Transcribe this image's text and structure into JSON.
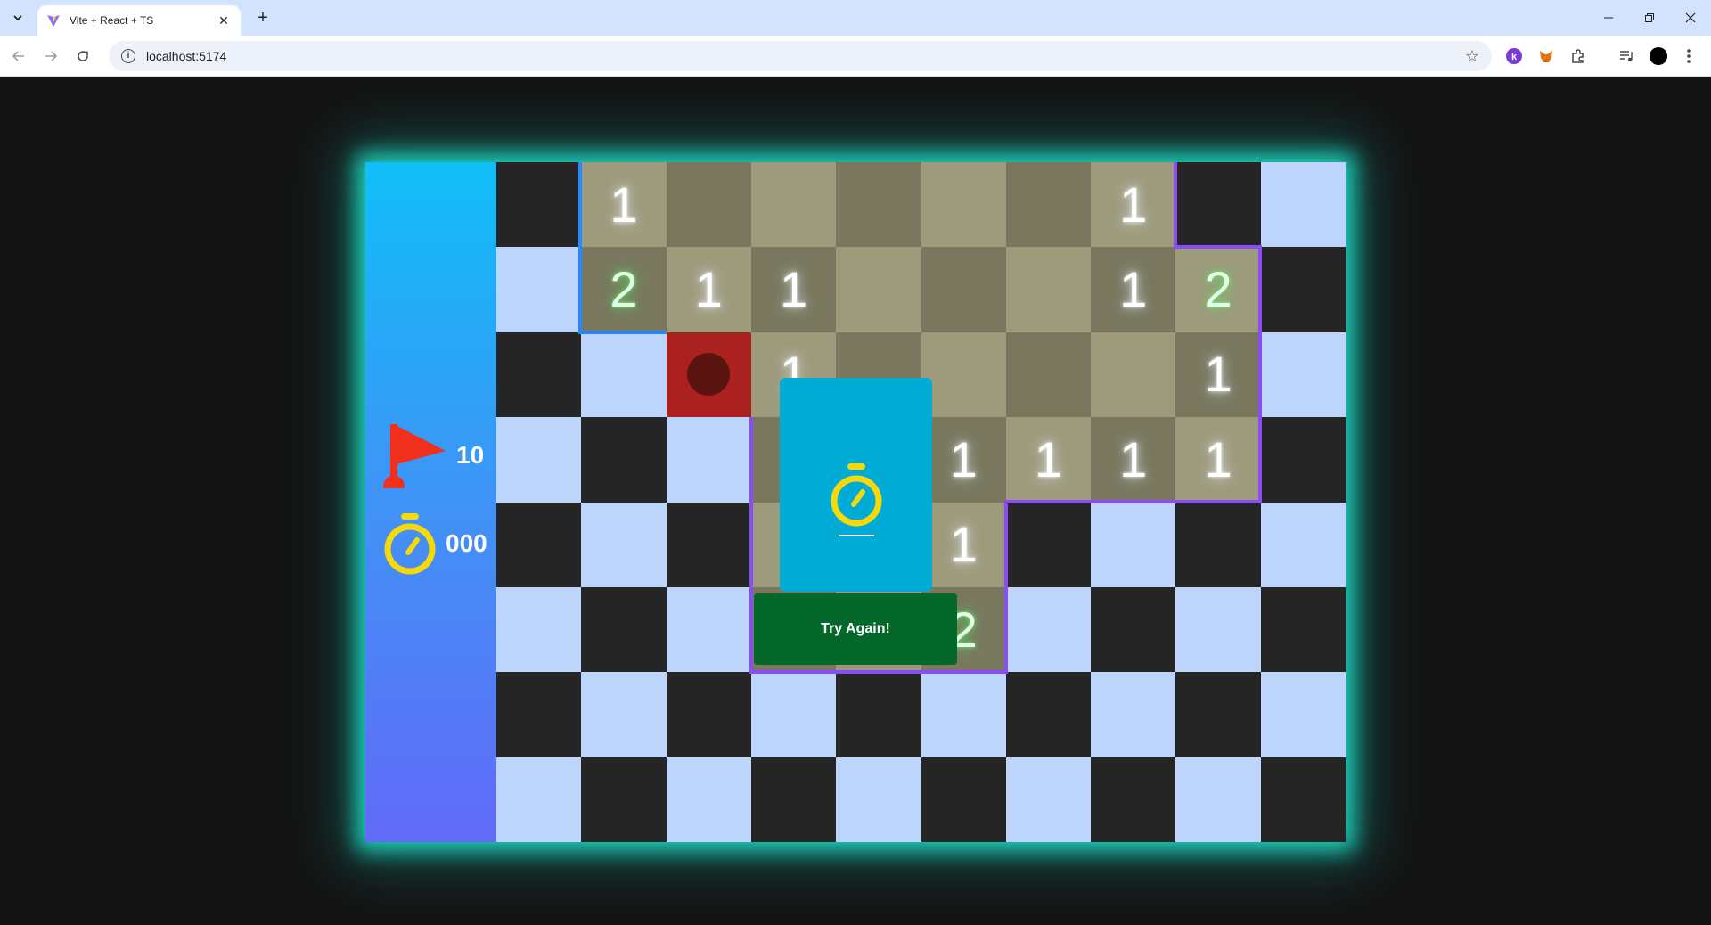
{
  "browser": {
    "tab_title": "Vite + React + TS",
    "url": "localhost:5174",
    "new_tab_symbol": "+",
    "close_symbol": "✕"
  },
  "game": {
    "flags_remaining": "10",
    "timer": "000",
    "modal_time": "",
    "retry_label": "Try Again!",
    "colors": {
      "sidebar_top": "#10bff8",
      "sidebar_bottom": "#626af8",
      "unrevealed_dark": "#252525",
      "unrevealed_light": "#bdd5fb",
      "revealed_a": "#9e9b7d",
      "revealed_b": "#79785f",
      "mine_cell": "#ab2120",
      "glow": "#1ee6cd",
      "modal": "#00acd6",
      "button": "#04682b",
      "flag": "#f0301c",
      "timer_icon": "#f5d90a"
    },
    "grid": {
      "cols": 10,
      "rows": 8,
      "legend": "D=unrevealed dark, L=unrevealed light, A=revealed (light tone), B=revealed (dark tone), M=exploded mine; digit suffix = adjacent count",
      "cells": [
        [
          "D",
          "A1",
          "B",
          "A",
          "B",
          "A",
          "B",
          "A1",
          "D",
          "L"
        ],
        [
          "L",
          "B2",
          "A1",
          "B1",
          "A",
          "B",
          "A",
          "B1",
          "A2",
          "D"
        ],
        [
          "D",
          "L",
          "M",
          "A1",
          "B",
          "A",
          "B",
          "A",
          "B1",
          "L"
        ],
        [
          "L",
          "D",
          "L",
          "B",
          "A",
          "B1",
          "A1",
          "B1",
          "A1",
          "D"
        ],
        [
          "D",
          "L",
          "D",
          "A",
          "B",
          "A1",
          "D",
          "L",
          "D",
          "L"
        ],
        [
          "L",
          "D",
          "L",
          "B",
          "A",
          "B2",
          "L",
          "D",
          "L",
          "D"
        ],
        [
          "D",
          "L",
          "D",
          "L",
          "D",
          "L",
          "D",
          "L",
          "D",
          "L"
        ],
        [
          "L",
          "D",
          "L",
          "D",
          "L",
          "D",
          "L",
          "D",
          "L",
          "D"
        ]
      ]
    }
  }
}
